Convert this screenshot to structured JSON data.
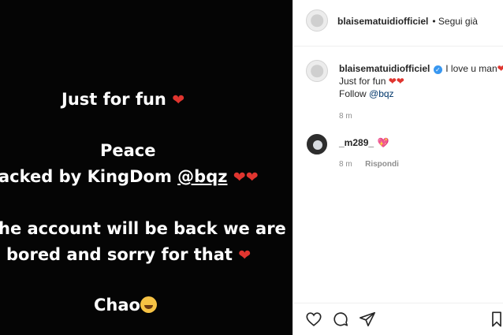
{
  "story": {
    "line1": "Just for fun",
    "line2": "Peace",
    "line3_prefix": "acked by KingDom ",
    "line3_handle": "@bqz",
    "line4": "he account will be back we are",
    "line5": "bored and sorry for that",
    "line6": "Chao"
  },
  "header": {
    "username": "blaisematuidiofficiel",
    "follow_text": "• Segui già"
  },
  "caption": {
    "username": "blaisematuidiofficiel",
    "text": "I love u man",
    "line2": "Just for fun",
    "line3_prefix": "Follow ",
    "line3_handle": "@bqz",
    "time": "8 m"
  },
  "comment": {
    "username": "_m289_",
    "time": "8 m",
    "reply_label": "Rispondi"
  },
  "icons": {
    "like": "heart-outline-icon",
    "comment": "comment-icon",
    "share": "send-icon",
    "save": "bookmark-icon",
    "heart_color": "#e0352f"
  }
}
